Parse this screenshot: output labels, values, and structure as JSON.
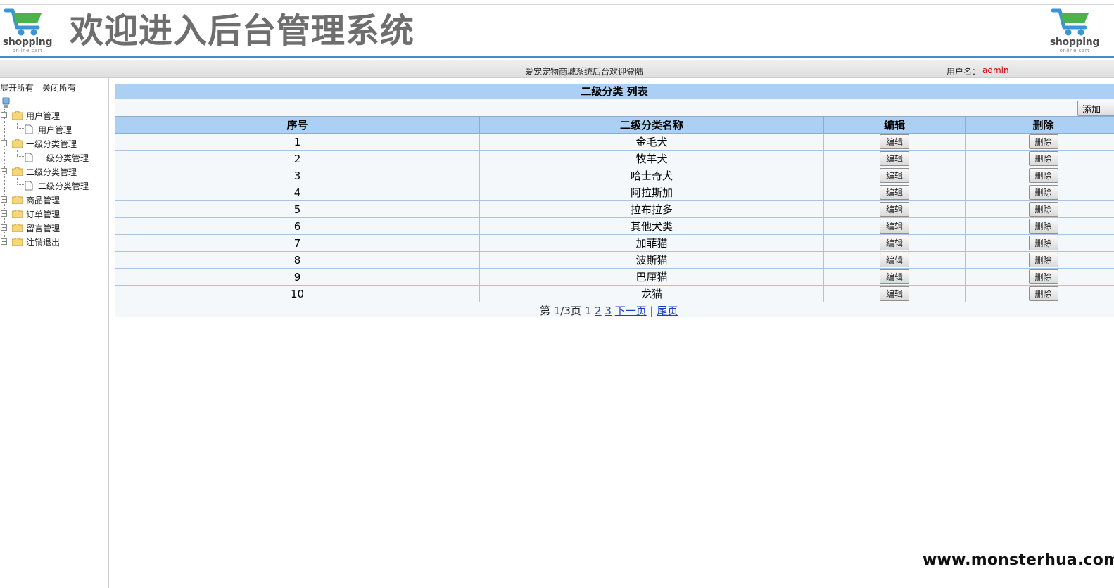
{
  "header": {
    "title": "欢迎进入后台管理系统",
    "logo_text": "shopping",
    "logo_subtext": "online cart"
  },
  "status_bar": {
    "welcome": "爱宠宠物商城系统后台欢迎登陆",
    "user_label": "用户名：",
    "user_value": "admin"
  },
  "sidebar": {
    "expand_all": "展开所有",
    "collapse_all": "关闭所有",
    "nodes": [
      {
        "label": "用户管理",
        "expanded": true,
        "children": [
          "用户管理"
        ]
      },
      {
        "label": "一级分类管理",
        "expanded": true,
        "children": [
          "一级分类管理"
        ]
      },
      {
        "label": "二级分类管理",
        "expanded": true,
        "children": [
          "二级分类管理"
        ]
      },
      {
        "label": "商品管理",
        "expanded": false,
        "children": []
      },
      {
        "label": "订单管理",
        "expanded": false,
        "children": []
      },
      {
        "label": "留言管理",
        "expanded": false,
        "children": []
      },
      {
        "label": "注销退出",
        "expanded": false,
        "children": []
      }
    ]
  },
  "main": {
    "list_title": "二级分类 列表",
    "add_label": "添加",
    "columns": [
      "序号",
      "二级分类名称",
      "编辑",
      "删除"
    ],
    "edit_label": "编辑",
    "delete_label": "删除",
    "rows": [
      {
        "id": "1",
        "name": "金毛犬"
      },
      {
        "id": "2",
        "name": "牧羊犬"
      },
      {
        "id": "3",
        "name": "哈士奇犬"
      },
      {
        "id": "4",
        "name": "阿拉斯加"
      },
      {
        "id": "5",
        "name": "拉布拉多"
      },
      {
        "id": "6",
        "name": "其他犬类"
      },
      {
        "id": "7",
        "name": "加菲猫"
      },
      {
        "id": "8",
        "name": "波斯猫"
      },
      {
        "id": "9",
        "name": "巴厘猫"
      },
      {
        "id": "10",
        "name": "龙猫"
      }
    ],
    "pager": {
      "prefix": "第 1/3页",
      "current": "1",
      "page_links": [
        "2",
        "3"
      ],
      "next": "下一页",
      "separator": "|",
      "last": "尾页"
    }
  },
  "watermark": "www.monsterhua.com",
  "colors": {
    "accent_bar": "#3d8fd0",
    "table_header": "#abd0f3",
    "username": "#d40000",
    "link": "#1a3fc7"
  }
}
